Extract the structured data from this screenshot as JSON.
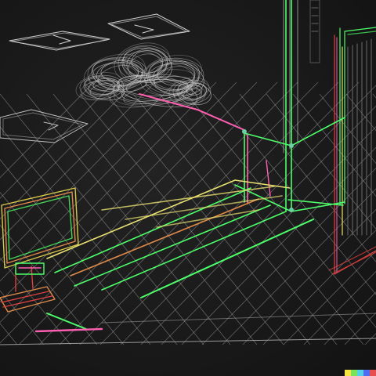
{
  "scene": {
    "subject": "wireframe-sketch",
    "background_color": "#1a1a1a",
    "line_colors": {
      "grid": "#b8b8b8",
      "cloud": "#d0d0d0",
      "green": "#4dff6a",
      "pink": "#ff5fb0",
      "yellow": "#e8e070",
      "orange": "#e08a4a",
      "red": "#d94040"
    }
  },
  "watermark": {
    "colors": [
      "#f5e642",
      "#7be35a",
      "#52d0e8",
      "#4f6cf0",
      "#e8504f"
    ]
  }
}
